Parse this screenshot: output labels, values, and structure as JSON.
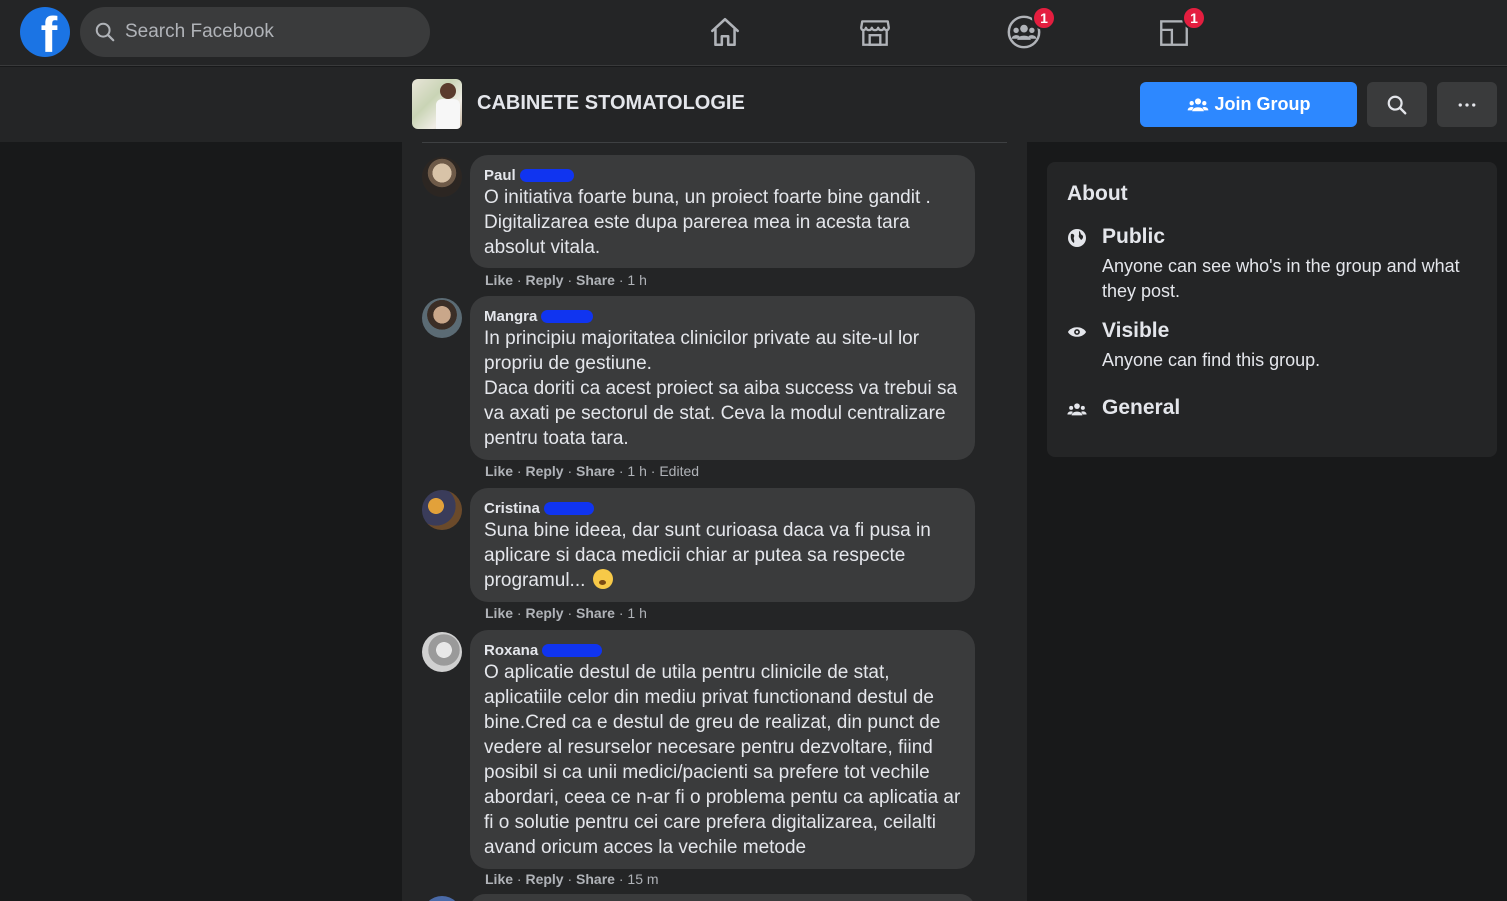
{
  "topnav": {
    "logo_icon": "facebook-logo-icon",
    "logo_letter": "f",
    "search_placeholder": "Search Facebook",
    "nav_icons": [
      "home-icon",
      "marketplace-icon",
      "groups-icon",
      "gaming-icon"
    ],
    "groups_badge": "1",
    "gaming_badge": "1"
  },
  "group": {
    "name": "CABINETE STOMATOLOGIE",
    "join_label": "Join Group",
    "accent_color": "#2d88ff"
  },
  "comments": [
    {
      "author": "Paul",
      "text": "O initiativa foarte buna, un proiect foarte bine gandit . Digitalizarea este dupa parerea mea in acesta tara absolut vitala.",
      "like": "Like",
      "reply": "Reply",
      "share": "Share",
      "time": "1 h"
    },
    {
      "author": "Mangra",
      "text_lines": [
        "In principiu majoritatea clinicilor private au site-ul lor propriu de gestiune.",
        "Daca doriti ca acest proiect sa aiba success va trebui sa va axati pe sectorul de stat. Ceva la modul centralizare pentru toata tara."
      ],
      "like": "Like",
      "reply": "Reply",
      "share": "Share",
      "time": "1 h",
      "edited": "Edited"
    },
    {
      "author": "Cristina",
      "text": "Suna bine ideea, dar sunt curioasa daca va fi pusa in aplicare si daca medicii chiar ar putea sa respecte programul...",
      "emoji": "thinking-face-emoji",
      "like": "Like",
      "reply": "Reply",
      "share": "Share",
      "time": "1 h"
    },
    {
      "author": "Roxana",
      "text": "O aplicatie destul de utila pentru clinicile de stat, aplicatiile celor din mediu privat functionand destul de bine.Cred ca e destul de greu de realizat, din punct de vedere al resurselor necesare pentru dezvoltare, fiind posibil si ca unii medici/pacienti sa prefere tot vechile abordari, ceea ce n-ar fi o problema pentu ca aplicatia ar fi o solutie pentru cei care prefera digitalizarea, ceilalti avand oricum acces la vechile metode",
      "like": "Like",
      "reply": "Reply",
      "share": "Share",
      "time": "15 m"
    }
  ],
  "about": {
    "title": "About",
    "items": [
      {
        "icon": "globe-icon",
        "title": "Public",
        "desc": "Anyone can see who's in the group and what they post."
      },
      {
        "icon": "eye-icon",
        "title": "Visible",
        "desc": "Anyone can find this group."
      },
      {
        "icon": "members-icon",
        "title": "General",
        "desc": ""
      }
    ]
  }
}
